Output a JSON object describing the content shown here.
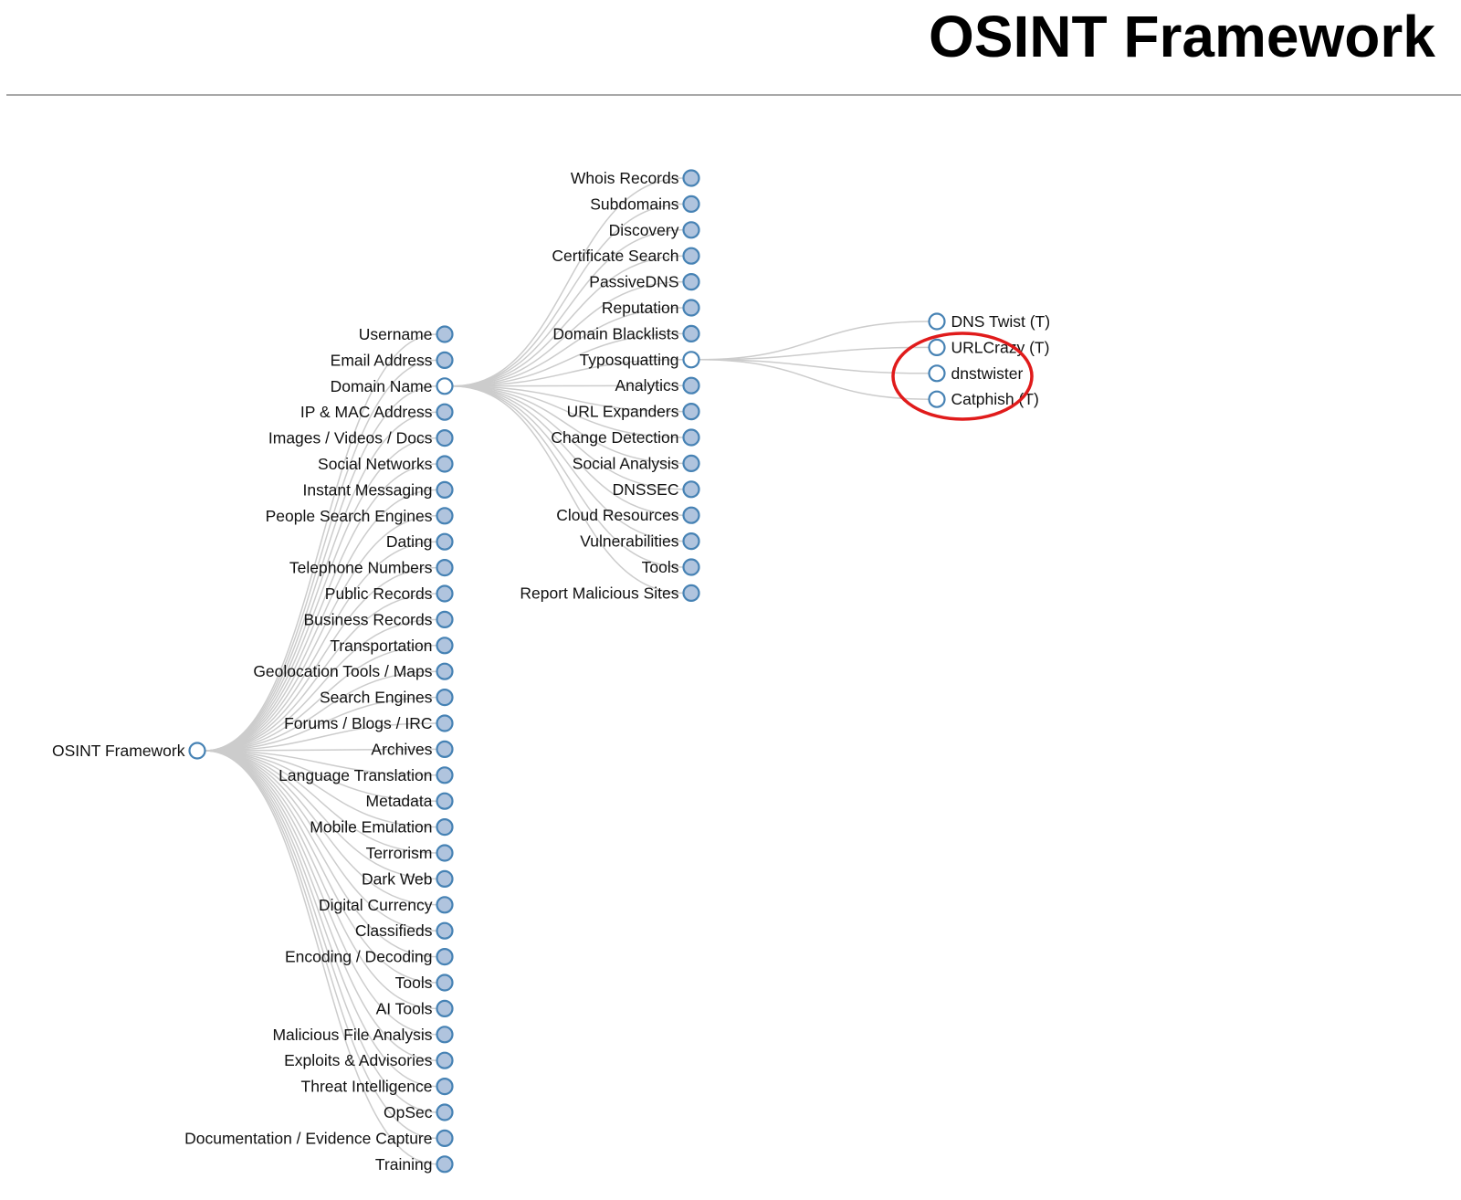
{
  "header": {
    "title": "OSINT Framework"
  },
  "colors": {
    "node_stroke": "#4682b4",
    "collapsed_fill": "#b0c4de",
    "expanded_fill": "#ffffff",
    "link": "#cccccc",
    "annotation": "#e01b1b"
  },
  "tree": {
    "root": {
      "label": "OSINT Framework",
      "expanded": true
    },
    "categories": [
      {
        "label": "Username",
        "expanded": false
      },
      {
        "label": "Email Address",
        "expanded": false
      },
      {
        "label": "Domain Name",
        "expanded": true
      },
      {
        "label": "IP & MAC Address",
        "expanded": false
      },
      {
        "label": "Images / Videos / Docs",
        "expanded": false
      },
      {
        "label": "Social Networks",
        "expanded": false
      },
      {
        "label": "Instant Messaging",
        "expanded": false
      },
      {
        "label": "People Search Engines",
        "expanded": false
      },
      {
        "label": "Dating",
        "expanded": false
      },
      {
        "label": "Telephone Numbers",
        "expanded": false
      },
      {
        "label": "Public Records",
        "expanded": false
      },
      {
        "label": "Business Records",
        "expanded": false
      },
      {
        "label": "Transportation",
        "expanded": false
      },
      {
        "label": "Geolocation Tools / Maps",
        "expanded": false
      },
      {
        "label": "Search Engines",
        "expanded": false
      },
      {
        "label": "Forums / Blogs / IRC",
        "expanded": false
      },
      {
        "label": "Archives",
        "expanded": false
      },
      {
        "label": "Language Translation",
        "expanded": false
      },
      {
        "label": "Metadata",
        "expanded": false
      },
      {
        "label": "Mobile Emulation",
        "expanded": false
      },
      {
        "label": "Terrorism",
        "expanded": false
      },
      {
        "label": "Dark Web",
        "expanded": false
      },
      {
        "label": "Digital Currency",
        "expanded": false
      },
      {
        "label": "Classifieds",
        "expanded": false
      },
      {
        "label": "Encoding / Decoding",
        "expanded": false
      },
      {
        "label": "Tools",
        "expanded": false
      },
      {
        "label": "AI Tools",
        "expanded": false
      },
      {
        "label": "Malicious File Analysis",
        "expanded": false
      },
      {
        "label": "Exploits & Advisories",
        "expanded": false
      },
      {
        "label": "Threat Intelligence",
        "expanded": false
      },
      {
        "label": "OpSec",
        "expanded": false
      },
      {
        "label": "Documentation / Evidence Capture",
        "expanded": false
      },
      {
        "label": "Training",
        "expanded": false
      }
    ],
    "domain_name_children": [
      {
        "label": "Whois Records",
        "expanded": false
      },
      {
        "label": "Subdomains",
        "expanded": false
      },
      {
        "label": "Discovery",
        "expanded": false
      },
      {
        "label": "Certificate Search",
        "expanded": false
      },
      {
        "label": "PassiveDNS",
        "expanded": false
      },
      {
        "label": "Reputation",
        "expanded": false
      },
      {
        "label": "Domain Blacklists",
        "expanded": false
      },
      {
        "label": "Typosquatting",
        "expanded": true
      },
      {
        "label": "Analytics",
        "expanded": false
      },
      {
        "label": "URL Expanders",
        "expanded": false
      },
      {
        "label": "Change Detection",
        "expanded": false
      },
      {
        "label": "Social Analysis",
        "expanded": false
      },
      {
        "label": "DNSSEC",
        "expanded": false
      },
      {
        "label": "Cloud Resources",
        "expanded": false
      },
      {
        "label": "Vulnerabilities",
        "expanded": false
      },
      {
        "label": "Tools",
        "expanded": false
      },
      {
        "label": "Report Malicious Sites",
        "expanded": false
      }
    ],
    "typosquatting_children": [
      {
        "label": "DNS Twist (T)",
        "leaf": true
      },
      {
        "label": "URLCrazy (T)",
        "leaf": true
      },
      {
        "label": "dnstwister",
        "leaf": true
      },
      {
        "label": "Catphish (T)",
        "leaf": true
      }
    ]
  },
  "annotation": {
    "shape": "ellipse",
    "encloses": [
      "URLCrazy (T)",
      "dnstwister",
      "Catphish (T)"
    ]
  }
}
